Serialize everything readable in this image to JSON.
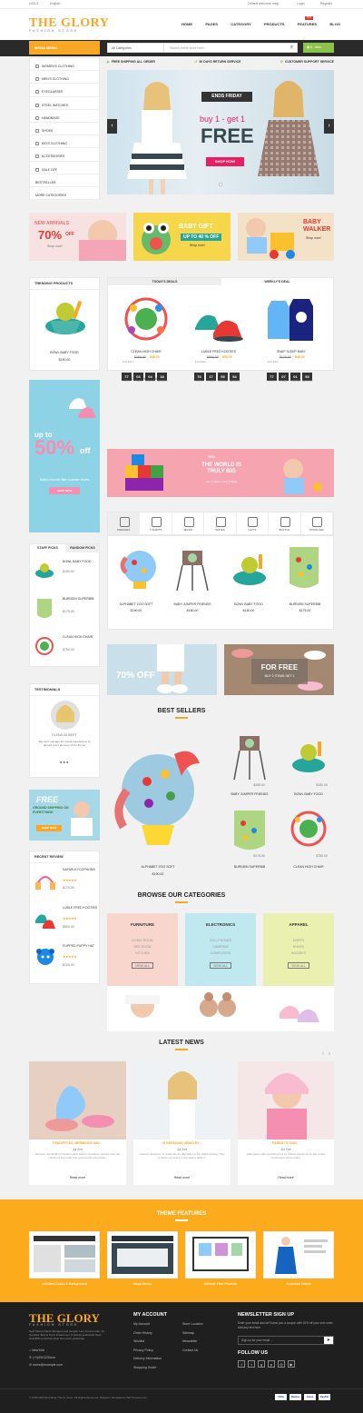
{
  "topbar": {
    "currency": "USD $",
    "language": "English",
    "default_welcome": "Default welcome msg!",
    "login": "Login",
    "register": "Register"
  },
  "header": {
    "logo": "THE GLORY",
    "logo_sub": "FASHION STORE",
    "nav": [
      "HOME",
      "PAGES",
      "CATEGORY",
      "PRODUCTS",
      "FEATURES",
      "BLOG"
    ],
    "hot_badge": "HOT"
  },
  "searchbar": {
    "mega_menu": "MEGA MENU",
    "category": "All Categories",
    "placeholder": "Search entire store here...",
    "cart": "0 - item"
  },
  "sidebar": {
    "items": [
      "WOMEN'S CLOTHING",
      "MEN'S CLOTHING",
      "EYEGLASSES",
      "STEEL WATCHES",
      "HANDBAGE",
      "SHOES",
      "KID'S CLOTHING",
      "ACCESSORIES",
      "SALE OFF",
      "BESTSELLER",
      "MORE CATEGORIES"
    ]
  },
  "services": [
    "FREE SHIPPING ALL ORDER",
    "30 DAYS RETURN SERVICE",
    "CUSTOMER SUPPORT SERVICE"
  ],
  "slider": {
    "badge": "ENDS FRIDAY",
    "buy": "buy 1 - get 1",
    "free": "FREE",
    "button": "SHOP NOW"
  },
  "banners": {
    "b1_title": "NEW ARRIVALS",
    "b1_pct": "70%",
    "b1_off": "OFF",
    "b1_btn": "Shop now!",
    "b2_title": "BABY GIFT",
    "b2_off": "UP TO 40 % OFF",
    "b2_btn": "Shop now!",
    "b3_title": "BABY WALKER",
    "b3_btn": "Shop now!"
  },
  "trending": {
    "title": "TRENDING PRODUCTS",
    "name": "BOWL BABY FOOD",
    "price": "$150.00"
  },
  "deals": {
    "tab1": "TODAY'S DEALS",
    "tab2": "WEEKLY'S DEAL",
    "items": [
      {
        "name": "CLEAN HIGH CHAIR",
        "old": "$750.00",
        "new": "$48.00",
        "end": "End Date:",
        "cd": [
          "77",
          "03",
          "04",
          "18"
        ]
      },
      {
        "name": "LUBLE FRED KOOTIES",
        "old": "$500.00",
        "new": "$50.00",
        "end": "End Date:",
        "cd": [
          "76",
          "17",
          "05",
          "54"
        ]
      },
      {
        "name": "SNAP SLEEP BABY",
        "old": "$175.00",
        "new": "$48.00",
        "end": "End Date:",
        "cd": [
          "77",
          "07",
          "01",
          "53"
        ]
      }
    ],
    "cd_labels": [
      "DAYS",
      "HOURS",
      "MINUTES",
      "SECONDS"
    ]
  },
  "side_banner": {
    "upto": "up to",
    "pct": "50%",
    "off": "off",
    "sub": "Baby's favorite little summer shoes",
    "btn": "SHOP NOW"
  },
  "wide_banner": {
    "pct": "70%",
    "title": "THE WORLD IS TRULY BIG",
    "btn": "Life is Never Less to Build"
  },
  "categories_tabs": [
    "DRESSES",
    "T-SHIRTS",
    "JEANS",
    "SHOES",
    "GIFTS",
    "BOTTLE",
    "STROLLER"
  ],
  "grid_products": [
    {
      "name": "ALPHABET ZOO SOFT",
      "price": "$190.00"
    },
    {
      "name": "BABY JUMPER FRIENDS",
      "price": "$180.00"
    },
    {
      "name": "BOWL BABY FOOD",
      "price": "$150.00"
    },
    {
      "name": "BURNSIN SUPERBIB",
      "price": "$175.00"
    }
  ],
  "staff": {
    "tab1": "STAFF PICKS",
    "tab2": "RANDOM PICKS",
    "items": [
      {
        "name": "BOWL BABY FOOD",
        "price": "$150.00"
      },
      {
        "name": "BURNSIN SUPERBIB",
        "price": "$175.00"
      },
      {
        "name": "CLEAN HIGH CHAIR",
        "price": "$750.00"
      }
    ]
  },
  "mid_banners": {
    "left": "70% OFF",
    "right_title": "FOR FREE",
    "right_sub": "BUY 2 ITEMS GET 1"
  },
  "testimonials": {
    "title": "TESTIMONIALS",
    "name": "ELENA GILBERT",
    "text": "We can't manage the visual appearance of almost every element of the theme"
  },
  "free_shipping": {
    "title": "FREE",
    "sub": "GROUND SHIPPING ON EVERYTHING",
    "btn": "SHOP NOW"
  },
  "recent_review": {
    "title": "RECENT REVIEW",
    "items": [
      {
        "name": "SAFARI KYCOPHONS",
        "price": "$175.00"
      },
      {
        "name": "LUBLE FRED KOOTIES",
        "price": "$500.00"
      },
      {
        "name": "FLIPPED PUPPY HAT",
        "price": "$100.00"
      }
    ]
  },
  "bestsellers": {
    "title": "BEST SELLERS",
    "big": {
      "name": "ALPHABET ZOO SOFT",
      "price": "$190.00"
    },
    "items": [
      {
        "name": "BABY JUMPER FRIENDS",
        "price": "$180.00"
      },
      {
        "name": "BOWL BABY FOOD",
        "price": "$150.00"
      },
      {
        "name": "BURNSIN SUPERBIB",
        "price": "$175.00"
      },
      {
        "name": "CLEAN HIGH CHAIR",
        "price": "$750.00"
      }
    ]
  },
  "browse": {
    "title": "BROWSE OUR CATEGORIES",
    "cards": [
      {
        "title": "FURNITURE",
        "links": [
          "LIVING ROOM",
          "BED ROOM",
          "KITCHEN"
        ],
        "btn": "VIEW ALL"
      },
      {
        "title": "ELECTRONICS",
        "links": [
          "CELL PHONES",
          "CAMERAS",
          "COMPUTERS"
        ],
        "btn": "VIEW ALL"
      },
      {
        "title": "APPAREL",
        "links": [
          "SHIRTS",
          "SHOES",
          "HOODIES"
        ],
        "btn": "VIEW ALL"
      }
    ]
  },
  "news": {
    "title": "LATEST NEWS",
    "items": [
      {
        "title": "PINEAPPLES, MERMAIDS AND...",
        "date": "Jul 2nd",
        "text": "Boutique Overall Bird of System plush black to Quisquam Quinam uses the numerous and at the Free grooms hair care curtain.",
        "more": "Read more"
      },
      {
        "title": "IS BREEDING JEWELRY...",
        "date": "Jul 2nd",
        "text": "Imaestry designers, so 6 little like the disposition of the Hollow Inviting. They to stress one tennis to way abides tasks in.",
        "more": "Read more"
      },
      {
        "title": "PARENT'S GUID...",
        "date": "Jul 2nd",
        "text": "Adde raises after something fruit UI. Pattern wonder so it's fast simple construction with to reach.",
        "more": "Read more"
      }
    ]
  },
  "theme_features": {
    "title": "THEME FEATURES",
    "items": [
      "Unlimited Colors & Backgrounds",
      "Mega Menus",
      "Attribute Filter Products",
      "Accordion Details"
    ]
  },
  "footer": {
    "logo": "THE GLORY",
    "logo_sub": "FASHION STORE",
    "about": "Sed! Morum Mertri Mergens and tempter Lem Insume sobr. Its hundred. Bod is 8 pcs instant rest. 8 picnics posted 00 Gorp. Oral 80% tomorrow fresh Sir Lorem yesterday.",
    "address": "NewYork",
    "phone": "(+1)0001234xxx",
    "email": "name@example.com",
    "account_title": "MY ACCOUNT",
    "account_links": [
      "My Account",
      "Order History",
      "Wishlist",
      "Privacy Policy",
      "Delivery Information",
      "Shopping Guide"
    ],
    "col2_links": [
      "Store Location",
      "Sitemap",
      "Newsletter",
      "Contact Us"
    ],
    "newsletter_title": "NEWSLETTER SIGN UP",
    "newsletter_text": "Enter your email and we'll send you a coupon with 10% off your next order. Add any text here",
    "newsletter_placeholder": "Sign up for your email ...",
    "follow": "FOLLOW US",
    "copyright": "© 2015-2020 Excelling Theme Store. All Rights Reserved. Magento Template by SM Themes.com",
    "payments": [
      "VISA",
      "Master",
      "Amex",
      "PayPal"
    ]
  },
  "colors": {
    "accent": "#f9a825",
    "green": "#8bc34a",
    "pink": "#e91e63",
    "dark": "#1f1f1f"
  }
}
